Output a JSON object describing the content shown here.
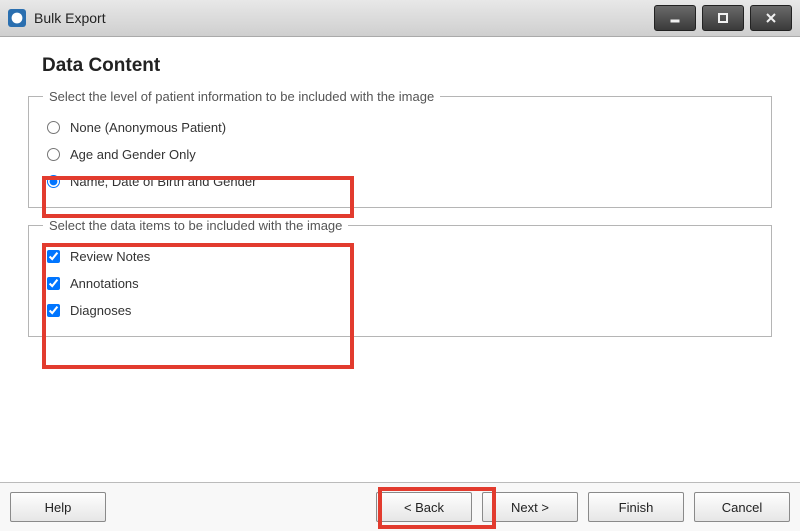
{
  "window": {
    "title": "Bulk Export"
  },
  "heading": "Data Content",
  "group_patient": {
    "legend": "Select the level of patient information to be included with the image",
    "options": [
      {
        "label": "None (Anonymous Patient)",
        "selected": false
      },
      {
        "label": "Age and Gender Only",
        "selected": false
      },
      {
        "label": "Name, Date of Birth and Gender",
        "selected": true
      }
    ]
  },
  "group_data": {
    "legend": "Select the data items to be included with the image",
    "options": [
      {
        "label": "Review Notes",
        "checked": true
      },
      {
        "label": "Annotations",
        "checked": true
      },
      {
        "label": "Diagnoses",
        "checked": true
      }
    ]
  },
  "buttons": {
    "help": "Help",
    "back": "< Back",
    "next": "Next >",
    "finish": "Finish",
    "cancel": "Cancel"
  }
}
